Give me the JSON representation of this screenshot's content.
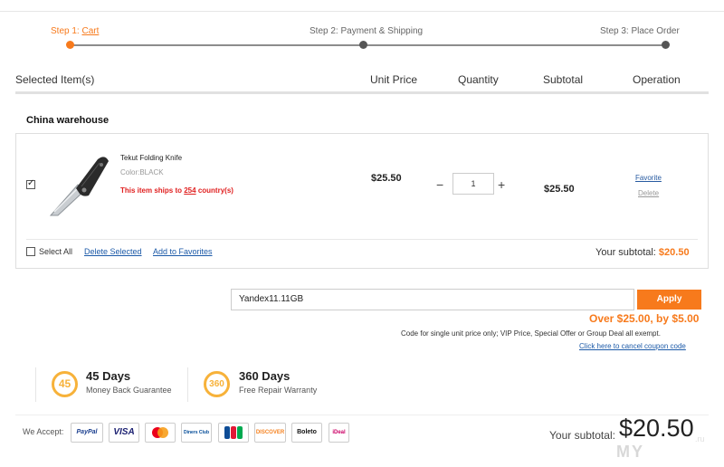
{
  "steps": [
    {
      "label": "Step 1: ",
      "link": "Cart"
    },
    {
      "label": "Step 2: Payment & Shipping"
    },
    {
      "label": "Step 3: Place Order"
    }
  ],
  "columns": {
    "selected": "Selected Item(s)",
    "unit_price": "Unit Price",
    "quantity": "Quantity",
    "subtotal": "Subtotal",
    "operation": "Operation"
  },
  "warehouse": "China warehouse",
  "item": {
    "name": "Tekut Folding Knife",
    "color": "Color:BLACK",
    "ships_prefix": "This item ships to ",
    "ships_count": "254",
    "ships_suffix": " country(s)",
    "unit_price": "$25.50",
    "quantity": "1",
    "subtotal": "$25.50",
    "favorite": "Favorite",
    "delete": "Delete",
    "checked": true
  },
  "cart_actions": {
    "select_all": "Select All",
    "delete_selected": "Delete Selected",
    "add_to_favorites": "Add to Favorites",
    "your_subtotal_label": "Your subtotal: ",
    "your_subtotal_amount": "$20.50"
  },
  "coupon": {
    "value": "Yandex11.11GB",
    "apply": "Apply",
    "discount": "Over $25.00, by $5.00",
    "note": "Code for single unit price only; VIP Price, Special Offer or Group Deal all exempt.",
    "cancel": "Click here to cancel coupon code"
  },
  "guarantees": [
    {
      "badge": "45",
      "title": "45 Days",
      "subtitle": "Money Back Guarantee"
    },
    {
      "badge": "360",
      "title": "360 Days",
      "subtitle": "Free Repair Warranty"
    }
  ],
  "payment": {
    "label": "We Accept:",
    "methods": [
      "PayPal",
      "VISA",
      "MasterCard",
      "Diners Club",
      "JCB",
      "DISCOVER",
      "Boleto",
      "iDeal"
    ]
  },
  "footer": {
    "subtotal_label": "Your subtotal:",
    "subtotal_amount": "$20.50"
  },
  "watermark": {
    "text": "MY",
    "suffix": ".ru"
  },
  "colors": {
    "accent": "#f77a1c",
    "link": "#1c5aa8",
    "error": "#e02020",
    "badge": "#f7b23a"
  }
}
